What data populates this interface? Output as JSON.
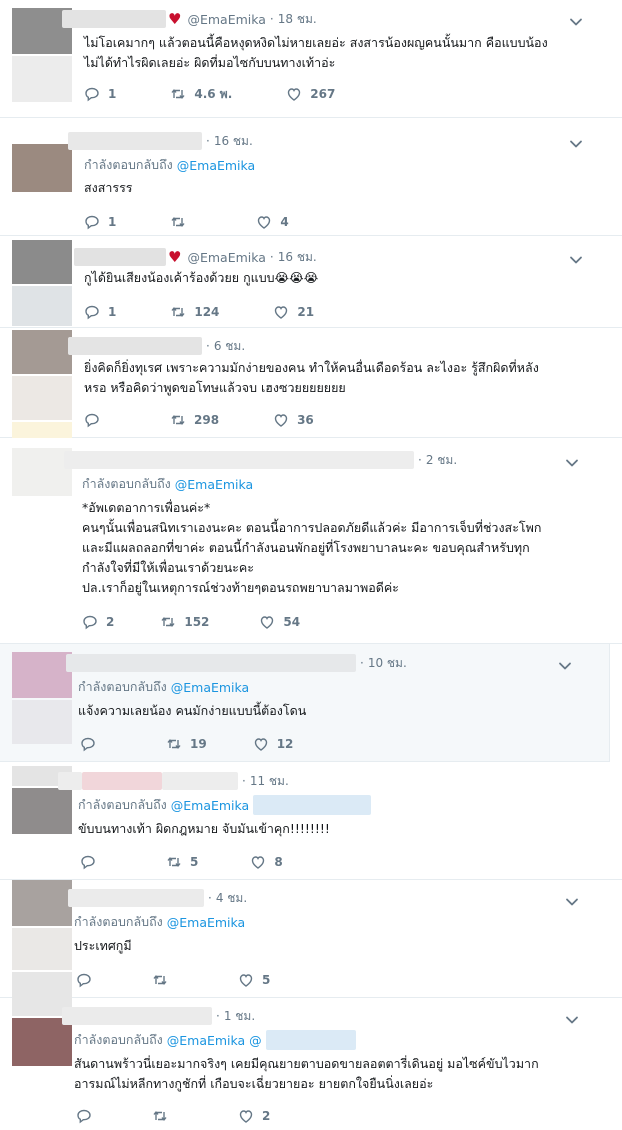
{
  "colors": {
    "link": "#1b95e0",
    "muted": "#657786",
    "text": "#14171a",
    "heart": "#c8102e"
  },
  "tweets": [
    {
      "handle": "@EmaEmika",
      "time": "18 ชม.",
      "reply_prefix": "",
      "reply_at": "",
      "text": "ไม่โอเคมากๆ แล้วตอนนี้คือหงุดหงิดไม่หายเลยอ่ะ สงสารน้องผญคนนั้นมาก คือแบบน้อง\nไม่ได้ทำไรผิดเลยอ่ะ ผิดที่มอไซกับบนทางเท้าอ่ะ",
      "replies": "1",
      "retweets": "4.6 พ.",
      "likes": "267"
    },
    {
      "handle": "",
      "time": "16 ชม.",
      "reply_prefix": "กำลังตอบกลับถึง",
      "reply_at": "@EmaEmika",
      "text": "สงสารรร",
      "replies": "1",
      "retweets": "",
      "likes": "4"
    },
    {
      "handle": "@EmaEmika",
      "time": "16 ชม.",
      "reply_prefix": "",
      "reply_at": "",
      "text": "กูได้ยินเสียงน้องเค้าร้องด้วยย กูแบบ😭😭😭",
      "replies": "1",
      "retweets": "124",
      "likes": "21"
    },
    {
      "handle": "",
      "time": "6 ชม.",
      "reply_prefix": "",
      "reply_at": "",
      "text": "ยิ่งคิดก็ยิ่งทุเรศ เพราะความมักง่ายของคน ทำให้คนอื่นเดือดร้อน ละไงอะ รู้สึกผิดที่หลัง\nหรอ หรือคิดว่าพูดขอโทษแล้วจบ เฮงซวยยยยยยย",
      "replies": "",
      "retweets": "298",
      "likes": "36"
    },
    {
      "handle": "",
      "time": "2 ชม.",
      "reply_prefix": "กำลังตอบกลับถึง",
      "reply_at": "@EmaEmika",
      "text": "*อัพเดตอาการเพื่อนค่ะ*\nคนๆนั้นเพื่อนสนิทเราเองนะคะ ตอนนี้อาการปลอดภัยดีแล้วค่ะ มีอาการเจ็บที่ช่วงสะโพก\nและมีแผลถลอกที่ขาค่ะ ตอนนี้กำลังนอนพักอยู่ที่โรงพยาบาลนะคะ ขอบคุณสำหรับทุก\nกำลังใจที่มีให้เพื่อนเราด้วยนะคะ\nปล.เราก็อยู่ในเหตุการณ์ช่วงท้ายๆตอนรถพยาบาลมาพอดีค่ะ",
      "replies": "2",
      "retweets": "152",
      "likes": "54"
    },
    {
      "handle": "",
      "time": "10 ชม.",
      "reply_prefix": "กำลังตอบกลับถึง",
      "reply_at": "@EmaEmika",
      "text": "แจ้งความเลยน้อง คนมักง่ายแบบนี้ต้องโดน",
      "replies": "",
      "retweets": "19",
      "likes": "12"
    },
    {
      "handle": "",
      "time": "11 ชม.",
      "reply_prefix": "กำลังตอบกลับถึง",
      "reply_at": "@EmaEmika",
      "text": "ขับบนทางเท้า ผิดกฎหมาย จับมันเข้าคุก!!!!!!!!",
      "replies": "",
      "retweets": "5",
      "likes": "8"
    },
    {
      "handle": "",
      "time": "4 ชม.",
      "reply_prefix": "กำลังตอบกลับถึง",
      "reply_at": "@EmaEmika",
      "text": "ประเทศกูมี",
      "replies": "",
      "retweets": "",
      "likes": "5"
    },
    {
      "handle": "",
      "time": "1 ชม.",
      "reply_prefix": "กำลังตอบกลับถึง",
      "reply_at": "@EmaEmika @",
      "text": "สันดานพร้าวนี่เยอะมากจริงๆ เคยมีคุณยายตาบอดขายลอตตารี่เดินอยู่ มอไซค์ขับไวมาก\nอารมณ์ไม่หลีกทางกูชักที่ เกือบจะเฉี่ยวยายอะ ยายตกใจยืนนิ่งเลยอ่ะ",
      "replies": "",
      "retweets": "",
      "likes": "2"
    }
  ]
}
